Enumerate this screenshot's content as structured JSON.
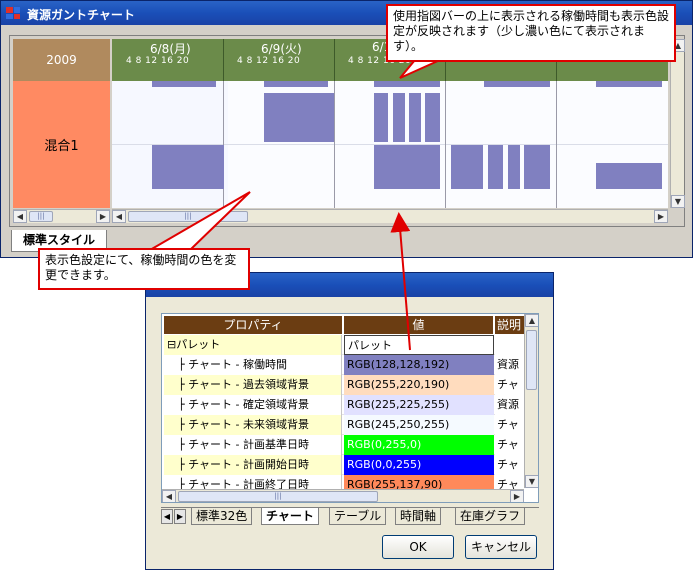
{
  "main_window": {
    "title": "資源ガントチャート",
    "app_icon_colors": [
      "#e0302a",
      "#2f6de0",
      "#2f6de0",
      "#e0302a"
    ],
    "resource_header": "2009",
    "resource_name": "混合1",
    "days": [
      {
        "date": "6/8(月)",
        "hours": "4  8 12 16 20"
      },
      {
        "date": "6/9(火)",
        "hours": "4  8 12 16 20"
      },
      {
        "date": "6/10",
        "hours": "4  8 12 16 20"
      },
      {
        "date": "",
        "hours": ""
      },
      {
        "date": "",
        "hours": ""
      }
    ],
    "style_tab": "標準スタイル"
  },
  "callouts": {
    "top_right": "使用指図バーの上に表示される稼働時間も表示色設定が反映されます（少し濃い色にて表示されます）。",
    "left": "表示色設定にて、稼働時間の色を変更できます。"
  },
  "dialog": {
    "columns": [
      "プロパティ",
      "値",
      "説明"
    ],
    "rows": [
      {
        "name": "⊟パレット",
        "value": "パレット",
        "desc": "",
        "value_color": "#ffffff",
        "value_text_color": "#000000"
      },
      {
        "name": "　├ チャート - 稼働時間",
        "value": "RGB(128,128,192)",
        "desc": "資源",
        "value_color": "#8080c0",
        "value_text_color": "#000000"
      },
      {
        "name": "　├ チャート - 過去領域背景",
        "value": "RGB(255,220,190)",
        "desc": "チャ",
        "value_color": "#ffdcbe",
        "value_text_color": "#000000"
      },
      {
        "name": "　├ チャート - 確定領域背景",
        "value": "RGB(225,225,255)",
        "desc": "資源",
        "value_color": "#e1e1ff",
        "value_text_color": "#000000"
      },
      {
        "name": "　├ チャート - 未来領域背景",
        "value": "RGB(245,250,255)",
        "desc": "チャ",
        "value_color": "#f5faff",
        "value_text_color": "#000000"
      },
      {
        "name": "　├ チャート - 計画基準日時",
        "value": "RGB(0,255,0)",
        "desc": "チャ",
        "value_color": "#00ff00",
        "value_text_color": "#ffffff"
      },
      {
        "name": "　├ チャート - 計画開始日時",
        "value": "RGB(0,0,255)",
        "desc": "チャ",
        "value_color": "#0000ff",
        "value_text_color": "#ffffff"
      },
      {
        "name": "　├ チャート - 計画終了日時",
        "value": "RGB(255,137,90)",
        "desc": "チャ",
        "value_color": "#ff895a",
        "value_text_color": "#000000"
      }
    ],
    "tabs": [
      "標準32色",
      "チャート",
      "テーブル",
      "時間軸",
      "在庫グラフ"
    ],
    "active_tab": 1,
    "ok_label": "OK",
    "cancel_label": "キャンセル"
  }
}
